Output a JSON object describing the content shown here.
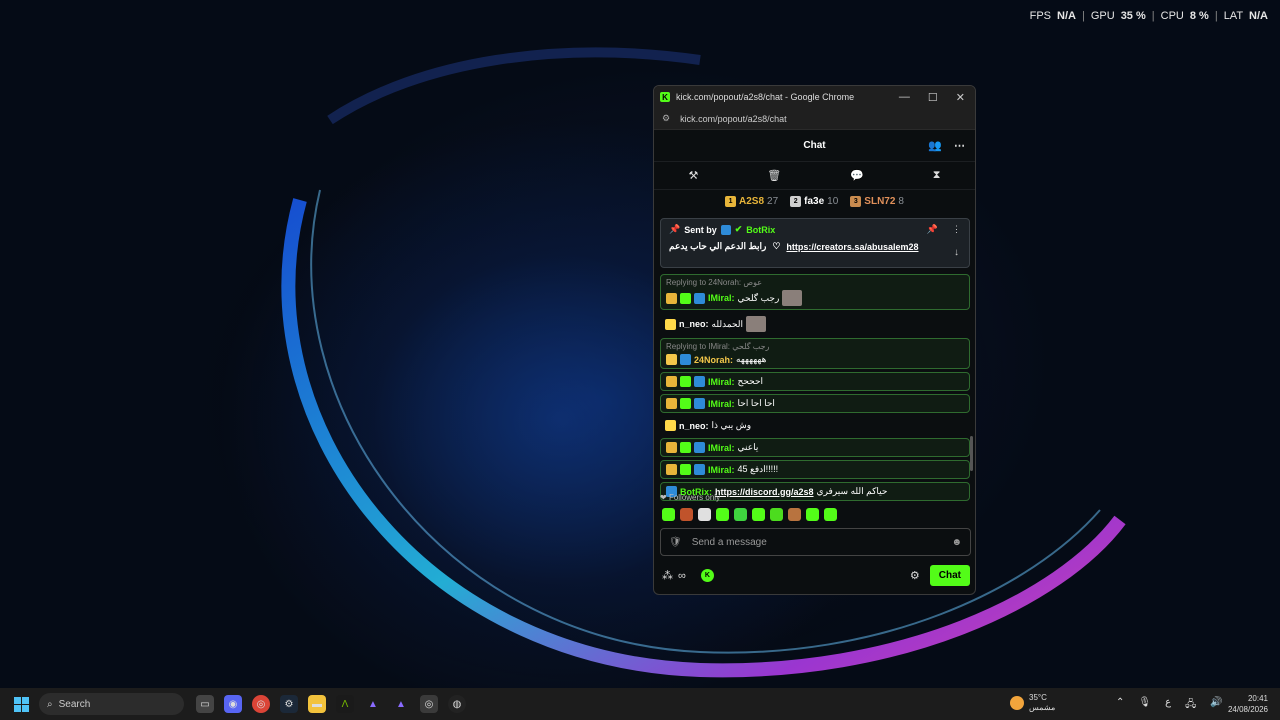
{
  "perf": {
    "fps_label": "FPS",
    "fps_value": "N/A",
    "gpu_label": "GPU",
    "gpu_value": "35 %",
    "cpu_label": "CPU",
    "cpu_value": "8 %",
    "lat_label": "LAT",
    "lat_value": "N/A"
  },
  "window": {
    "title": "kick.com/popout/a2s8/chat - Google Chrome",
    "url": "kick.com/popout/a2s8/chat",
    "minimize": "—",
    "maximize": "☐",
    "close": "✕"
  },
  "chat": {
    "header": "Chat",
    "leaderboard": [
      {
        "rank": "1",
        "name": "A2S8",
        "points": "27",
        "color": "#e8b53a",
        "name_color": "#e8b53a"
      },
      {
        "rank": "2",
        "name": "fa3e",
        "points": "10",
        "color": "#cfcfcf",
        "name_color": "#ffffff"
      },
      {
        "rank": "3",
        "name": "SLN72",
        "points": "8",
        "color": "#c98b4f",
        "name_color": "#e0905a"
      }
    ],
    "pinned": {
      "sent_by": "Sent by",
      "bot": "BotRix",
      "text": "رابط الدعم الي حاب يدعم",
      "link": "https://creators.sa/abusalem28"
    },
    "messages": [
      {
        "reply": "Replying to 24Norah: عوص",
        "user": "IMiral:",
        "user_color": "#53fc18",
        "text": "رجب گلحي",
        "badges": [
          "b-gold",
          "b-sub",
          "b-blue"
        ]
      },
      {
        "user": "n_neo:",
        "user_color": "#ffffff",
        "text": "الحمدلله",
        "badges": [
          "b-n"
        ]
      },
      {
        "reply": "Replying to IMiral: رجب گلحي",
        "user": "24Norah:",
        "user_color": "#f3c74a",
        "text": "ههههههه",
        "badges": [
          "b-vip",
          "b-blue"
        ]
      },
      {
        "user": "IMiral:",
        "user_color": "#53fc18",
        "text": "احححح",
        "badges": [
          "b-gold",
          "b-sub",
          "b-blue"
        ]
      },
      {
        "user": "IMiral:",
        "user_color": "#53fc18",
        "text": "احا احا احا",
        "badges": [
          "b-gold",
          "b-sub",
          "b-blue"
        ]
      },
      {
        "user": "n_neo:",
        "user_color": "#ffffff",
        "text": "وش يبي ذا",
        "badges": [
          "b-n"
        ]
      },
      {
        "user": "IMiral:",
        "user_color": "#53fc18",
        "text": "ياعني",
        "badges": [
          "b-gold",
          "b-sub",
          "b-blue"
        ]
      },
      {
        "user": "IMiral:",
        "user_color": "#53fc18",
        "text": "45 ادفع!!!!!",
        "badges": [
          "b-gold",
          "b-sub",
          "b-blue"
        ]
      },
      {
        "user": "BotRix:",
        "user_color": "#53fc18",
        "link": "https://discord.gg/a2s8",
        "text": "حياكم الله سيرفري",
        "badges": [
          "b-blue"
        ]
      }
    ],
    "followers_only": "Followers only",
    "send_placeholder": "Send a message",
    "chat_button": "Chat"
  },
  "taskbar": {
    "search": "Search",
    "weather_temp": "35°C",
    "weather_desc": "مشمس",
    "lang": "ع",
    "time": "20:41",
    "date": "24/08/2026"
  },
  "colors": {
    "accent": "#53fc18"
  }
}
